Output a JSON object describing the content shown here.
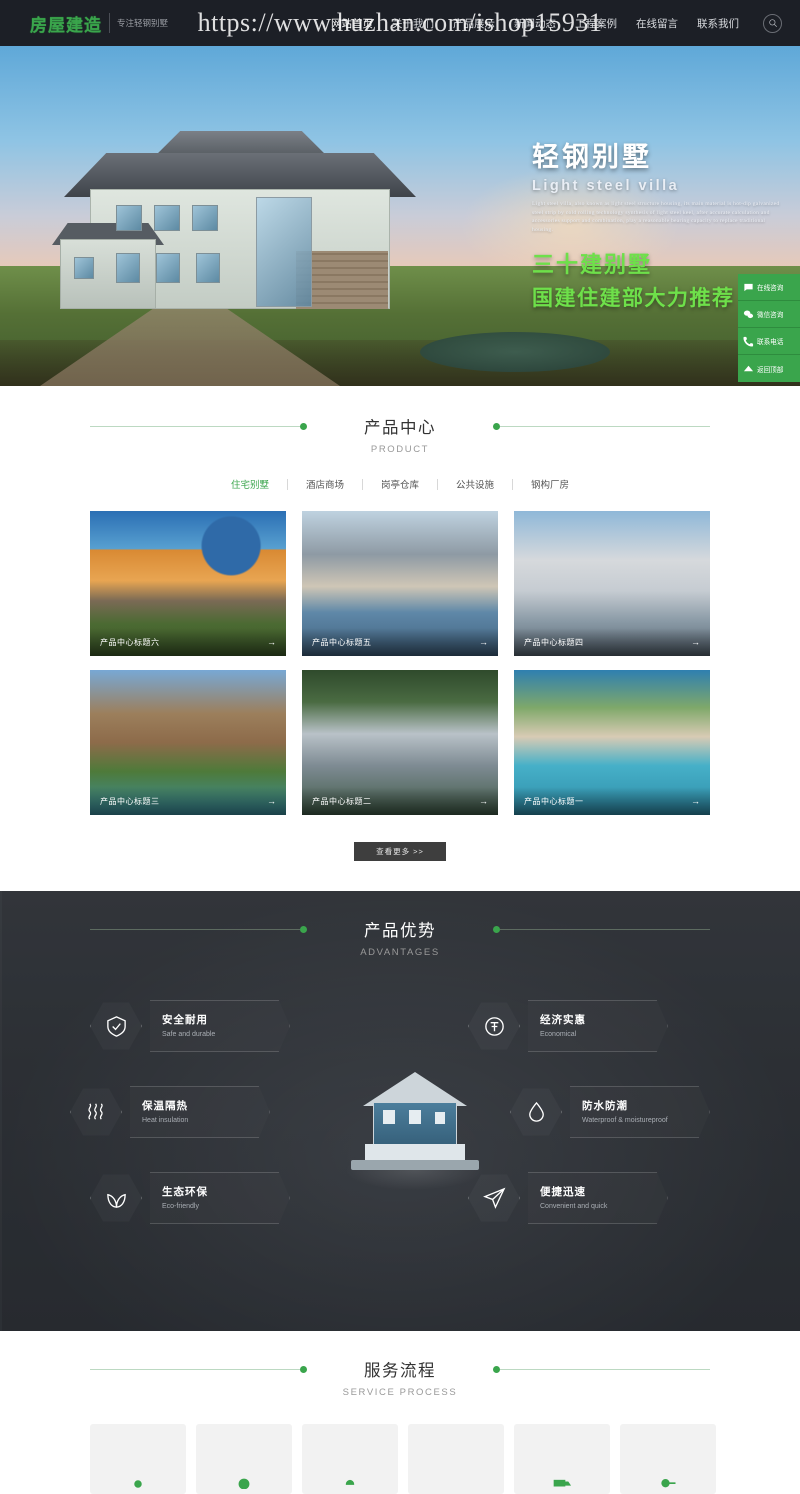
{
  "header": {
    "logo_text": "房屋建造",
    "logo_sub_line1": "专注轻钢别墅",
    "nav": [
      {
        "label": "网站首页",
        "active": true
      },
      {
        "label": "关于我们",
        "active": false
      },
      {
        "label": "产品展示",
        "active": false
      },
      {
        "label": "新闻动态",
        "active": false
      },
      {
        "label": "工程案例",
        "active": false
      },
      {
        "label": "在线留言",
        "active": false
      },
      {
        "label": "联系我们",
        "active": false
      }
    ],
    "search_icon": "search-icon",
    "watermark": "https://www.huzhan.com/ishop15931"
  },
  "banner": {
    "title_cn": "轻钢别墅",
    "title_en": "Light steel villa",
    "paragraph": "Light steel villa, also known as light steel structure housing, its main material is hot-dip galvanized steel strip by cold rolling technology synthesis of light steel keel, after accurate calculation and accessories support and combination, play a reasonable bearing capacity to replace traditional housing.",
    "green_line1": "三十建别墅",
    "green_line2": "国建住建部大力推荐"
  },
  "side_bar": [
    {
      "label": "在线咨询",
      "icon": "chat-icon"
    },
    {
      "label": "微信咨询",
      "icon": "wechat-icon"
    },
    {
      "label": "联系电话",
      "icon": "phone-icon"
    },
    {
      "label": "返回顶部",
      "icon": "chevron-up-icon"
    }
  ],
  "product": {
    "title_cn": "产品中心",
    "title_en": "PRODUCT",
    "tabs": [
      {
        "label": "住宅别墅",
        "active": true
      },
      {
        "label": "酒店商场",
        "active": false
      },
      {
        "label": "岗亭仓库",
        "active": false
      },
      {
        "label": "公共设施",
        "active": false
      },
      {
        "label": "钢构厂房",
        "active": false
      }
    ],
    "cards": [
      {
        "title": "产品中心标题六",
        "arrow": "→"
      },
      {
        "title": "产品中心标题五",
        "arrow": "→"
      },
      {
        "title": "产品中心标题四",
        "arrow": "→"
      },
      {
        "title": "产品中心标题三",
        "arrow": "→"
      },
      {
        "title": "产品中心标题二",
        "arrow": "→"
      },
      {
        "title": "产品中心标题一",
        "arrow": "→"
      }
    ],
    "more_label": "查看更多 >>"
  },
  "advantages": {
    "title_cn": "产品优势",
    "title_en": "ADVANTAGES",
    "left": [
      {
        "cn": "安全耐用",
        "en": "Safe and durable",
        "icon": "shield-check-icon"
      },
      {
        "cn": "保温隔热",
        "en": "Heat insulation",
        "icon": "heat-waves-icon"
      },
      {
        "cn": "生态环保",
        "en": "Eco-friendly",
        "icon": "leaf-icon"
      }
    ],
    "right": [
      {
        "cn": "经济实惠",
        "en": "Economical",
        "icon": "coin-yuan-icon"
      },
      {
        "cn": "防水防潮",
        "en": "Waterproof & moistureproof",
        "icon": "water-drop-icon"
      },
      {
        "cn": "便捷迅速",
        "en": "Convenient and quick",
        "icon": "paper-plane-icon"
      }
    ]
  },
  "service": {
    "title_cn": "服务流程",
    "title_en": "SERVICE PROCESS",
    "steps": [
      {
        "icon": "dot-icon"
      },
      {
        "icon": "circle-icon"
      },
      {
        "icon": "pin-icon"
      },
      {
        "icon": "blank-icon"
      },
      {
        "icon": "truck-icon"
      },
      {
        "icon": "key-icon"
      }
    ]
  },
  "colors": {
    "accent_green": "#3aa54c",
    "header_bg": "#1c1f26",
    "dark_section_bg": "#34383e",
    "banner_green_text": "#6ee04a"
  }
}
